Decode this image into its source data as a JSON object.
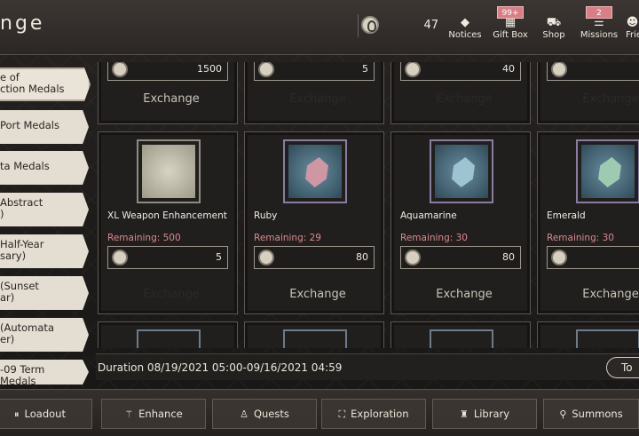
{
  "header": {
    "title": "nge",
    "medal_count": "47",
    "buttons": [
      {
        "label": "Notices",
        "icon": "◆",
        "badge": ""
      },
      {
        "label": "Gift Box",
        "icon": "▦",
        "badge": "99+"
      },
      {
        "label": "Shop",
        "icon": "⛟",
        "badge": ""
      },
      {
        "label": "Missions",
        "icon": "☰",
        "badge": "2"
      },
      {
        "label": "Frie",
        "icon": "☻",
        "badge": ""
      }
    ]
  },
  "categories": [
    {
      "line1": "e of",
      "line2": "ction Medals"
    },
    {
      "line1": "Port Medals",
      "line2": ""
    },
    {
      "line1": "ta Medals",
      "line2": ""
    },
    {
      "line1": "Abstract",
      "line2": ")"
    },
    {
      "line1": "Half-Year",
      "line2": "sary)"
    },
    {
      "line1": "(Sunset",
      "line2": "ar)"
    },
    {
      "line1": "(Automata",
      "line2": "er)"
    },
    {
      "line1": "-09 Term",
      "line2": "Medals"
    }
  ],
  "top_row": [
    {
      "cost": "1500",
      "button": "Exchange"
    },
    {
      "cost": "5",
      "button": "Exchange"
    },
    {
      "cost": "40",
      "button": "Exchange"
    },
    {
      "cost": "",
      "button": "Exchange"
    }
  ],
  "items": [
    {
      "name": "XL Weapon Enhancement",
      "remaining": "Remaining: 500",
      "cost": "5",
      "button": "Exchange",
      "state": "on",
      "color": "#e9e6dc"
    },
    {
      "name": "Ruby",
      "remaining": "Remaining: 29",
      "cost": "80",
      "button": "Exchange",
      "state": "off",
      "color": "#cc8a96"
    },
    {
      "name": "Aquamarine",
      "remaining": "Remaining: 30",
      "cost": "80",
      "button": "Exchange",
      "state": "off",
      "color": "#7fb0c0"
    },
    {
      "name": "Emerald",
      "remaining": "Remaining: 30",
      "cost": "",
      "button": "Exchange",
      "state": "off",
      "color": "#7fb59a"
    }
  ],
  "duration": "Duration 08/19/2021 05:00-09/16/2021 04:59",
  "to_button": "To",
  "bottom_nav": [
    {
      "label": "Loadout",
      "icon": "⏸"
    },
    {
      "label": "Enhance",
      "icon": "⚚"
    },
    {
      "label": "Quests",
      "icon": "♙"
    },
    {
      "label": "Exploration",
      "icon": "⛶"
    },
    {
      "label": "Library",
      "icon": "♜"
    },
    {
      "label": "Summons",
      "icon": "⚲"
    }
  ]
}
